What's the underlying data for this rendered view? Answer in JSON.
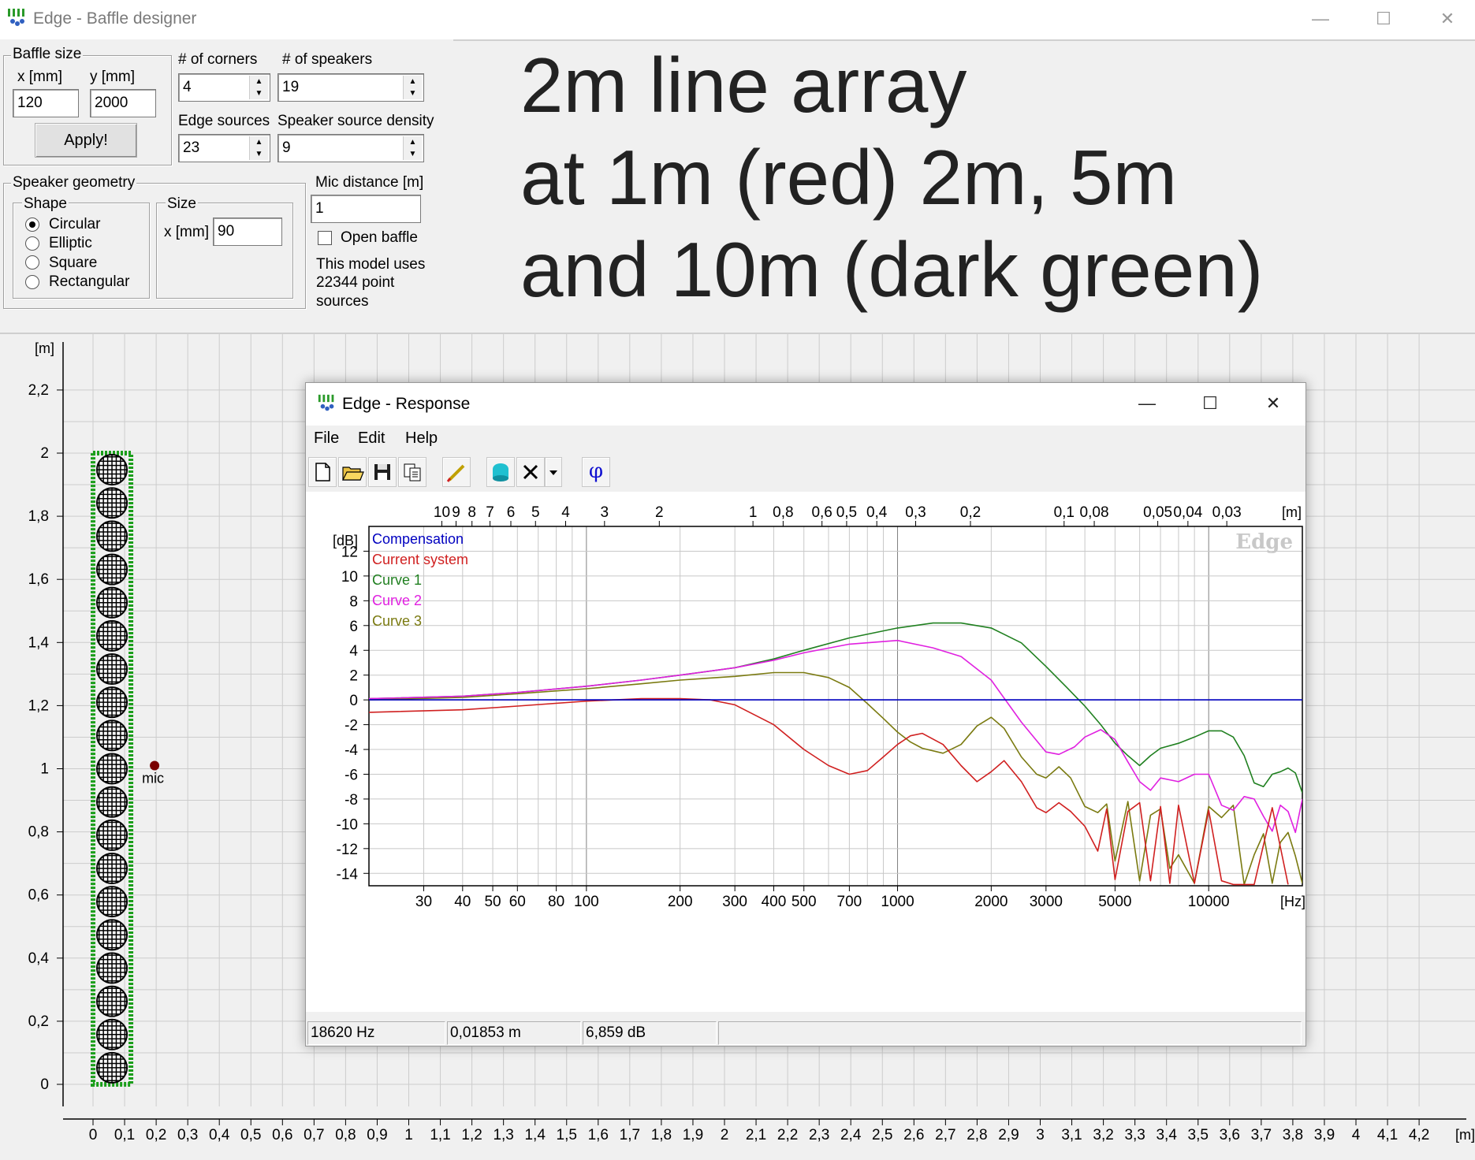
{
  "window": {
    "title": "Edge - Baffle designer",
    "minimize": "—",
    "maximize": "☐",
    "close": "✕"
  },
  "baffle_size": {
    "label": "Baffle size",
    "x_label": "x [mm]",
    "y_label": "y [mm]",
    "x_value": "120",
    "y_value": "2000",
    "apply_label": "Apply!"
  },
  "corners": {
    "label": "# of corners",
    "value": "4"
  },
  "speakers": {
    "label": "# of speakers",
    "value": "19"
  },
  "edge_sources": {
    "label": "Edge sources",
    "value": "23"
  },
  "speaker_density": {
    "label": "Speaker source density",
    "value": "9"
  },
  "speaker_geometry": {
    "label": "Speaker geometry",
    "shape_label": "Shape",
    "shapes": [
      "Circular",
      "Elliptic",
      "Square",
      "Rectangular"
    ],
    "selected_shape": "Circular",
    "size_label": "Size",
    "size_x_label": "x [mm]",
    "size_x_value": "90"
  },
  "mic": {
    "label": "Mic distance [m]",
    "value": "1",
    "open_baffle_label": "Open baffle",
    "model_note_line1": "This model uses",
    "model_note_line2": "22344 point",
    "model_note_line3": "sources"
  },
  "annotation": {
    "line1": "2m line array",
    "line2": "at 1m (red) 2m, 5m",
    "line3": "and 10m (dark green)"
  },
  "geometry_view": {
    "unit_label": "[m]",
    "y_ticks": [
      "2,2",
      "2",
      "1,8",
      "1,6",
      "1,4",
      "1,2",
      "1",
      "0,8",
      "0,6",
      "0,4",
      "0,2",
      "0"
    ],
    "x_ticks": [
      "0",
      "0,1",
      "0,2",
      "0,3",
      "0,4",
      "0,5",
      "0,6",
      "0,7",
      "0,8",
      "0,9",
      "1",
      "1,1",
      "1,2",
      "1,3",
      "1,4",
      "1,5",
      "1,6",
      "1,7",
      "1,8",
      "1,9",
      "2",
      "2,1",
      "2,2",
      "2,3",
      "2,4",
      "2,5",
      "2,6",
      "2,7",
      "2,8",
      "2,9",
      "3",
      "3,1",
      "3,2",
      "3,3",
      "3,4",
      "3,5",
      "3,6",
      "3,7",
      "3,8",
      "3,9",
      "4",
      "4,1",
      "4,2"
    ],
    "mic_label": "mic",
    "baffle": {
      "width_m": 0.12,
      "height_m": 2.0,
      "speakers": 19
    },
    "mic_position": {
      "x_m": 0.15,
      "y_m": 1.0
    },
    "colors": {
      "baffle": "#1a9e1a",
      "mic": "#7a0000",
      "speaker": "#000000"
    }
  },
  "response_window": {
    "title": "Edge - Response",
    "menu": [
      "File",
      "Edit",
      "Help"
    ],
    "toolbar_icons": [
      "new-icon",
      "open-icon",
      "save-icon",
      "copy-icon",
      "pen-icon",
      "speaker-icon",
      "delete-icon",
      "dropdown-icon",
      "phase-icon"
    ],
    "phase_glyph": "φ",
    "status": {
      "freq": "18620 Hz",
      "wavelength": "0,01853 m",
      "level": "6,859 dB"
    }
  },
  "chart_data": {
    "type": "line",
    "x_scale": "log",
    "xlim": [
      20,
      20000
    ],
    "ylim": [
      -15,
      14
    ],
    "ylabel": "[dB]",
    "xlabel": "[Hz]",
    "top_axis_label": "[m]",
    "watermark": "Edge",
    "x_tick_labels": [
      {
        "v": 30,
        "t": "30"
      },
      {
        "v": 40,
        "t": "40"
      },
      {
        "v": 50,
        "t": "50"
      },
      {
        "v": 60,
        "t": "60"
      },
      {
        "v": 80,
        "t": "80"
      },
      {
        "v": 100,
        "t": "100"
      },
      {
        "v": 200,
        "t": "200"
      },
      {
        "v": 300,
        "t": "300"
      },
      {
        "v": 400,
        "t": "400"
      },
      {
        "v": 500,
        "t": "500"
      },
      {
        "v": 700,
        "t": "700"
      },
      {
        "v": 1000,
        "t": "1000"
      },
      {
        "v": 2000,
        "t": "2000"
      },
      {
        "v": 3000,
        "t": "3000"
      },
      {
        "v": 5000,
        "t": "5000"
      },
      {
        "v": 10000,
        "t": "10000"
      }
    ],
    "top_tick_labels": [
      {
        "v": 10,
        "t": "10"
      },
      {
        "v": 9,
        "t": "9"
      },
      {
        "v": 8,
        "t": "8"
      },
      {
        "v": 7,
        "t": "7"
      },
      {
        "v": 6,
        "t": "6"
      },
      {
        "v": 5,
        "t": "5"
      },
      {
        "v": 4,
        "t": "4"
      },
      {
        "v": 3,
        "t": "3"
      },
      {
        "v": 2,
        "t": "2"
      },
      {
        "v": 1,
        "t": "1"
      },
      {
        "v": 0.8,
        "t": "0,8"
      },
      {
        "v": 0.6,
        "t": "0,6"
      },
      {
        "v": 0.5,
        "t": "0,5"
      },
      {
        "v": 0.4,
        "t": "0,4"
      },
      {
        "v": 0.3,
        "t": "0,3"
      },
      {
        "v": 0.2,
        "t": "0,2"
      },
      {
        "v": 0.1,
        "t": "0,1"
      },
      {
        "v": 0.08,
        "t": "0,08"
      },
      {
        "v": 0.05,
        "t": "0,05"
      },
      {
        "v": 0.04,
        "t": "0,04"
      },
      {
        "v": 0.03,
        "t": "0,03"
      }
    ],
    "y_ticks": [
      12,
      10,
      8,
      6,
      4,
      2,
      0,
      -2,
      -4,
      -6,
      -8,
      -10,
      -12,
      -14
    ],
    "series": [
      {
        "name": "Compensation",
        "color": "#0000c0",
        "x": [
          20,
          20000
        ],
        "y": [
          0,
          0
        ]
      },
      {
        "name": "Current system",
        "color": "#d02020",
        "x": [
          20,
          40,
          60,
          100,
          150,
          200,
          250,
          300,
          400,
          500,
          600,
          700,
          800,
          900,
          1000,
          1100,
          1200,
          1400,
          1600,
          1800,
          2000,
          2200,
          2500,
          2800,
          3000,
          3300,
          3600,
          4000,
          4400,
          4700,
          5000,
          5500,
          6000,
          6500,
          7000,
          7500,
          8000,
          9000,
          10000,
          11000,
          12000,
          14000,
          16000,
          18000
        ],
        "y": [
          -1.0,
          -0.8,
          -0.5,
          -0.1,
          0.1,
          0.1,
          0.0,
          -0.4,
          -2.0,
          -4.0,
          -5.3,
          -6.0,
          -5.7,
          -4.6,
          -3.6,
          -2.9,
          -2.7,
          -3.6,
          -5.3,
          -6.6,
          -5.8,
          -4.9,
          -6.6,
          -8.7,
          -9.1,
          -8.3,
          -9.0,
          -10.2,
          -12.2,
          -8.8,
          -14.5,
          -9.0,
          -8.3,
          -14.6,
          -8.6,
          -14.8,
          -8.5,
          -14.8,
          -8.9,
          -14.6,
          -14.9,
          -14.9,
          -8.7,
          -14.9
        ]
      },
      {
        "name": "Curve 1",
        "color": "#208020",
        "x": [
          20,
          40,
          60,
          100,
          150,
          200,
          300,
          400,
          500,
          700,
          1000,
          1300,
          1600,
          2000,
          2500,
          3000,
          3500,
          4000,
          4500,
          5000,
          5500,
          6000,
          6500,
          7000,
          8000,
          9000,
          10000,
          11000,
          12000,
          13000,
          14000,
          15000,
          16000,
          17000,
          18000,
          19000,
          20000
        ],
        "y": [
          0.1,
          0.3,
          0.6,
          1.1,
          1.6,
          2.0,
          2.6,
          3.3,
          4.0,
          5.0,
          5.8,
          6.2,
          6.2,
          5.8,
          4.6,
          2.7,
          1.0,
          -0.5,
          -2.0,
          -3.5,
          -4.5,
          -5.3,
          -4.5,
          -3.9,
          -3.5,
          -3.0,
          -2.5,
          -2.5,
          -3.0,
          -4.5,
          -6.7,
          -7.0,
          -6.0,
          -5.8,
          -5.5,
          -5.9,
          -7.5
        ]
      },
      {
        "name": "Curve 2",
        "color": "#e020e0",
        "x": [
          20,
          40,
          60,
          100,
          150,
          200,
          300,
          400,
          500,
          700,
          1000,
          1300,
          1600,
          2000,
          2500,
          3000,
          3300,
          3700,
          4000,
          4500,
          5000,
          5500,
          6000,
          6500,
          7000,
          8000,
          9000,
          10000,
          11000,
          12000,
          13000,
          14000,
          15000,
          16000,
          17000,
          18000,
          19000,
          20000
        ],
        "y": [
          0.1,
          0.3,
          0.6,
          1.1,
          1.6,
          2.0,
          2.6,
          3.2,
          3.8,
          4.5,
          4.8,
          4.2,
          3.5,
          1.6,
          -1.8,
          -4.2,
          -4.4,
          -3.8,
          -3.0,
          -2.4,
          -3.2,
          -5.0,
          -6.6,
          -7.3,
          -6.3,
          -6.6,
          -6.0,
          -6.0,
          -8.5,
          -8.9,
          -7.8,
          -8.0,
          -9.4,
          -10.6,
          -8.5,
          -9.0,
          -10.7,
          -8.0
        ]
      },
      {
        "name": "Curve 3",
        "color": "#7a7a10",
        "x": [
          20,
          40,
          60,
          100,
          150,
          200,
          300,
          400,
          500,
          600,
          700,
          800,
          900,
          1000,
          1100,
          1200,
          1400,
          1600,
          1800,
          2000,
          2200,
          2500,
          2800,
          3000,
          3300,
          3600,
          4000,
          4400,
          4700,
          5000,
          5500,
          6000,
          6500,
          7000,
          7500,
          8000,
          9000,
          10000,
          11000,
          12000,
          13000,
          14000,
          15000,
          16000,
          17000,
          18000,
          19000,
          20000
        ],
        "y": [
          0.0,
          0.2,
          0.5,
          0.9,
          1.3,
          1.6,
          1.9,
          2.2,
          2.2,
          1.8,
          1.0,
          -0.3,
          -1.5,
          -2.6,
          -3.4,
          -3.9,
          -4.3,
          -3.6,
          -2.1,
          -1.4,
          -2.3,
          -4.6,
          -6.0,
          -6.3,
          -5.4,
          -6.3,
          -8.6,
          -9.1,
          -8.4,
          -13.0,
          -8.2,
          -14.6,
          -9.3,
          -8.8,
          -13.6,
          -12.5,
          -14.8,
          -8.6,
          -9.5,
          -8.5,
          -14.9,
          -12.5,
          -10.8,
          -14.8,
          -11.5,
          -10.7,
          -12.6,
          -14.8
        ]
      }
    ]
  }
}
